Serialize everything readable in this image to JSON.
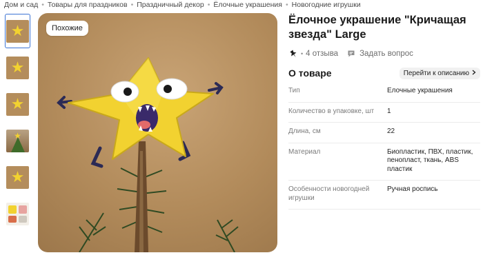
{
  "breadcrumbs": [
    "Дом и сад",
    "Товары для праздников",
    "Праздничный декор",
    "Ёлочные украшения",
    "Новогодние игрушки"
  ],
  "gallery": {
    "similar_label": "Похожие",
    "thumbnails": [
      "star-photo",
      "star-photo",
      "star-photo",
      "tree-photo",
      "star-photo",
      "infographic"
    ]
  },
  "product": {
    "title": "Ёлочное украшение \"Кричащая звезда\" Large",
    "reviews": "4 отзыва",
    "ask_question": "Задать вопрос"
  },
  "about": {
    "title": "О товаре",
    "go_to_description": "Перейти к описанию"
  },
  "attributes": [
    {
      "name": "Тип",
      "value": "Елочные украшения"
    },
    {
      "name": "Количество в упаковке, шт",
      "value": "1"
    },
    {
      "name": "Длина, см",
      "value": "22"
    },
    {
      "name": "Материал",
      "value": "Биопластик, ПВХ, пластик, пенопласт, ткань, ABS пластик"
    },
    {
      "name": "Особенности новогодней игрушки",
      "value": "Ручная роспись"
    }
  ],
  "colors": {
    "accent": "#3b73d4",
    "star": "#f2d230"
  }
}
